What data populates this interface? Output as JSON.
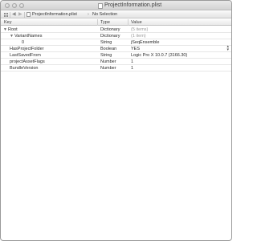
{
  "window": {
    "title": "ProjectInformation.plist"
  },
  "jumpbar": {
    "file": "ProjectInformation.plist",
    "separator": "›",
    "selection": "No Selection",
    "back": "◀",
    "forward": "▶"
  },
  "columns": {
    "key": "Key",
    "type": "Type",
    "value": "Value"
  },
  "rows": [
    {
      "key": "Root",
      "type": "Dictionary",
      "value": "(5 items)",
      "disclosure": "▼"
    },
    {
      "key": "VariantNames",
      "type": "Dictionary",
      "value": "(1 item)",
      "disclosure": "▼"
    },
    {
      "key": "0",
      "type": "String",
      "value": "jSeqEnsemble"
    },
    {
      "key": "HasProjectFolder",
      "type": "Boolean",
      "value": "YES"
    },
    {
      "key": "LastSavedFrom",
      "type": "String",
      "value": "Logic Pro X 10.0.7 (3166.30)"
    },
    {
      "key": "projectAssetFlags",
      "type": "Number",
      "value": "1"
    },
    {
      "key": "BundleVersion",
      "type": "Number",
      "value": "1"
    }
  ]
}
